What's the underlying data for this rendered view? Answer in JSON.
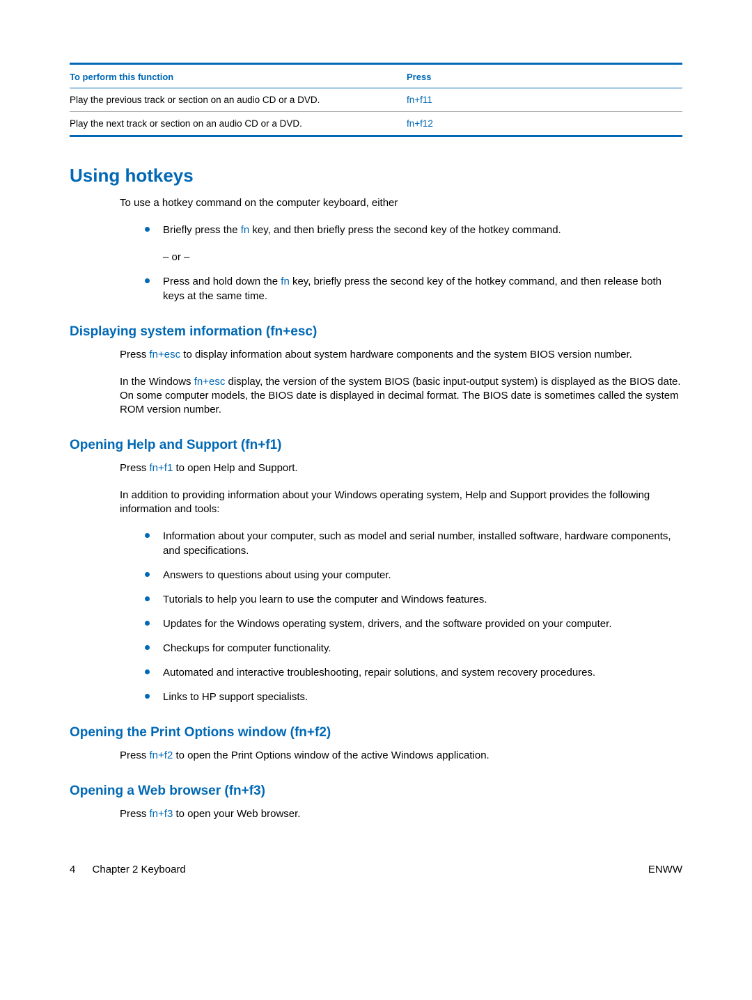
{
  "table": {
    "header_function": "To perform this function",
    "header_press": "Press",
    "rows": [
      {
        "function": "Play the previous track or section on an audio CD or a DVD.",
        "press": "fn+f11"
      },
      {
        "function": "Play the next track or section on an audio CD or a DVD.",
        "press": "fn+f12"
      }
    ]
  },
  "section_heading": "Using hotkeys",
  "intro": "To use a hotkey command on the computer keyboard, either",
  "bullets_main": {
    "b1_pre": "Briefly press the ",
    "b1_kw": "fn",
    "b1_post": " key, and then briefly press the second key of the hotkey command.",
    "or_text": "– or –",
    "b2_pre": "Press and hold down the ",
    "b2_kw": "fn",
    "b2_post": " key, briefly press the second key of the hotkey command, and then release both keys at the same time."
  },
  "sub1": {
    "heading": "Displaying system information (fn+esc)",
    "p1_pre": "Press ",
    "p1_kw": "fn+esc",
    "p1_post": " to display information about system hardware components and the system BIOS version number.",
    "p2_pre": "In the Windows ",
    "p2_kw": "fn+esc",
    "p2_post": " display, the version of the system BIOS (basic input-output system) is displayed as the BIOS date. On some computer models, the BIOS date is displayed in decimal format. The BIOS date is sometimes called the system ROM version number."
  },
  "sub2": {
    "heading": "Opening Help and Support (fn+f1)",
    "p1_pre": "Press ",
    "p1_kw": "fn+f1",
    "p1_post": " to open Help and Support.",
    "p2": "In addition to providing information about your Windows operating system, Help and Support provides the following information and tools:",
    "list": [
      "Information about your computer, such as model and serial number, installed software, hardware components, and specifications.",
      "Answers to questions about using your computer.",
      "Tutorials to help you learn to use the computer and Windows features.",
      "Updates for the Windows operating system, drivers, and the software provided on your computer.",
      "Checkups for computer functionality.",
      "Automated and interactive troubleshooting, repair solutions, and system recovery procedures.",
      "Links to HP support specialists."
    ]
  },
  "sub3": {
    "heading": "Opening the Print Options window (fn+f2)",
    "p1_pre": "Press ",
    "p1_kw": "fn+f2",
    "p1_post": " to open the Print Options window of the active Windows application."
  },
  "sub4": {
    "heading": "Opening a Web browser (fn+f3)",
    "p1_pre": "Press ",
    "p1_kw": "fn+f3",
    "p1_post": " to open your Web browser."
  },
  "footer": {
    "page_number": "4",
    "chapter": "Chapter 2   Keyboard",
    "right": "ENWW"
  }
}
